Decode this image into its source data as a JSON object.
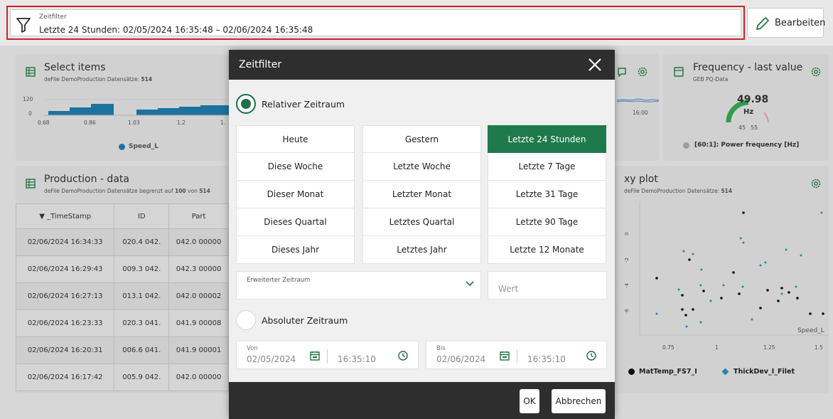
{
  "topbar": {
    "filter_caption": "Zeitfilter",
    "filter_value": "Letzte 24 Stunden: 02/05/2024 16:35:48 – 02/06/2024 16:35:48",
    "edit_label": "Bearbeiten"
  },
  "widgets": {
    "select_items": {
      "title": "Select items",
      "subtitle_prefix": "deFile DemoProduction Datensätze: ",
      "subtitle_count": "514",
      "y_ticks": [
        "120",
        "0"
      ],
      "x_ticks": [
        "0.68",
        "0.86",
        "1.03",
        "1.2",
        "1."
      ],
      "legend": "Speed_L"
    },
    "frequency": {
      "title": "Frequency - last value",
      "subtitle": "GEB PQ-Data",
      "value": "49.98",
      "unit": "Hz",
      "range_min": "45",
      "range_max": "55",
      "legend": "[60:1]: Power frequency [Hz]"
    },
    "line_chart": {
      "time_label": "16:00"
    },
    "production": {
      "title": "Production - data",
      "subtitle_prefix": "deFile DemoProduction Datensätze begrenzt auf ",
      "subtitle_limit": "100",
      "subtitle_mid": " von ",
      "subtitle_total": "514",
      "columns": [
        "▼ _TimeStamp",
        "ID",
        "Part"
      ],
      "rows": [
        [
          "02/06/2024 16:34:33",
          "020.4 042.",
          "042.0 00000"
        ],
        [
          "02/06/2024 16:29:43",
          "009.3 042.",
          "042.3 00000"
        ],
        [
          "02/06/2024 16:27:13",
          "013.1 042.",
          "042.0 00002"
        ],
        [
          "02/06/2024 16:23:33",
          "020.3 041.",
          "041.9 00008"
        ],
        [
          "02/06/2024 16:20:31",
          "006.6 041.",
          "041.9 00001"
        ],
        [
          "02/06/2024 16:17:42",
          "005.9 042.",
          "042.0 00000"
        ]
      ]
    },
    "xy_plot": {
      "title": "xy plot",
      "subtitle_prefix": "deFile DemoProduction Datensätze: ",
      "subtitle_count": "514",
      "y_ticks": [
        "0",
        "-2",
        "-4",
        "-6"
      ],
      "x_ticks": [
        "0.75",
        "1",
        "1.25",
        "1.5"
      ],
      "x_axis_label": "Speed_L",
      "legend": [
        "MatTemp_FS7_I",
        "ThickDev_I_Filet"
      ],
      "colors": {
        "series1": "#111111",
        "series2": "#2d8fc4"
      }
    }
  },
  "dialog": {
    "title": "Zeitfilter",
    "relative_label": "Relativer Zeitraum",
    "relative_checked": true,
    "absolute_label": "Absoluter Zeitraum",
    "absolute_checked": false,
    "grid": [
      [
        "Heute",
        "Diese Woche",
        "Dieser Monat",
        "Dieses Quartal",
        "Dieses Jahr"
      ],
      [
        "Gestern",
        "Letzte Woche",
        "Letzter Monat",
        "Letztes Quartal",
        "Letztes Jahr"
      ],
      [
        "Letzte 24 Stunden",
        "Letzte 7 Tage",
        "Letzte 31 Tage",
        "Letzte 90 Tage",
        "Letzte 12 Monate"
      ]
    ],
    "selected": "Letzte 24 Stunden",
    "extended_caption": "Erweiterter Zeitraum",
    "value_placeholder": "Wert",
    "from_caption": "Von",
    "from_date": "02/05/2024",
    "from_time": "16:35:10",
    "to_caption": "Bis",
    "to_date": "02/06/2024",
    "to_time": "16:35:10",
    "ok_label": "OK",
    "cancel_label": "Abbrechen",
    "accent": "#1f7a4b"
  }
}
